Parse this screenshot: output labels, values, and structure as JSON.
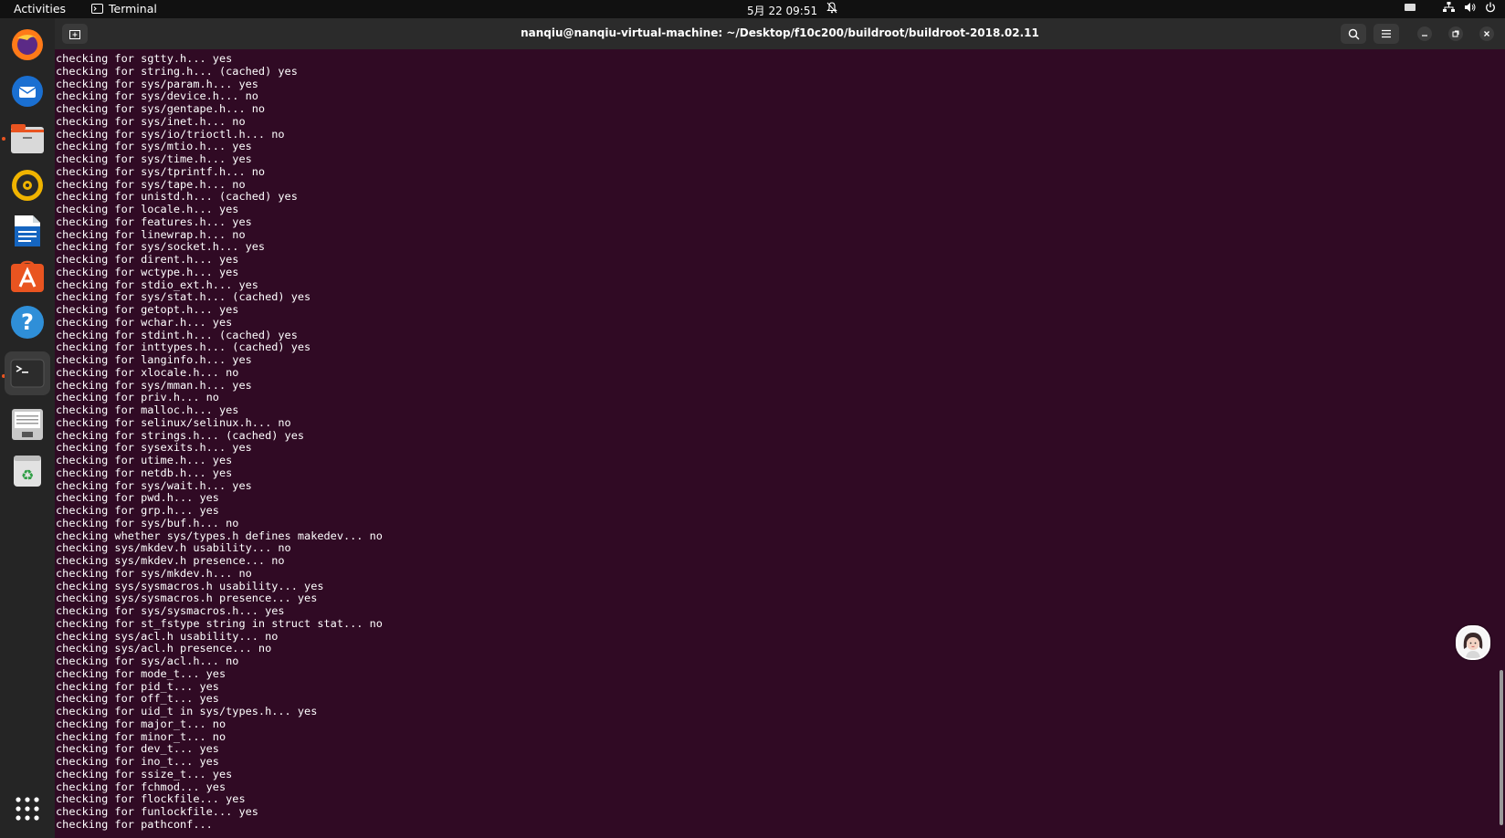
{
  "topbar": {
    "activities": "Activities",
    "app_name": "Terminal",
    "clock": "5月 22  09:51"
  },
  "dock": {
    "items": [
      "firefox-icon",
      "thunderbird-icon",
      "files-icon",
      "rhythmbox-icon",
      "writer-icon",
      "software-icon",
      "help-icon",
      "terminal-icon",
      "drive-icon",
      "trash-icon"
    ],
    "active_item": "terminal-icon"
  },
  "window": {
    "title": "nanqiu@nanqiu-virtual-machine: ~/Desktop/f10c200/buildroot/buildroot-2018.02.11"
  },
  "colors": {
    "terminal_bg": "#300a24",
    "terminal_fg": "#ffffff",
    "accent": "#e95420"
  },
  "terminal": {
    "lines": [
      "checking for sgtty.h... yes",
      "checking for string.h... (cached) yes",
      "checking for sys/param.h... yes",
      "checking for sys/device.h... no",
      "checking for sys/gentape.h... no",
      "checking for sys/inet.h... no",
      "checking for sys/io/trioctl.h... no",
      "checking for sys/mtio.h... yes",
      "checking for sys/time.h... yes",
      "checking for sys/tprintf.h... no",
      "checking for sys/tape.h... no",
      "checking for unistd.h... (cached) yes",
      "checking for locale.h... yes",
      "checking for features.h... yes",
      "checking for linewrap.h... no",
      "checking for sys/socket.h... yes",
      "checking for dirent.h... yes",
      "checking for wctype.h... yes",
      "checking for stdio_ext.h... yes",
      "checking for sys/stat.h... (cached) yes",
      "checking for getopt.h... yes",
      "checking for wchar.h... yes",
      "checking for stdint.h... (cached) yes",
      "checking for inttypes.h... (cached) yes",
      "checking for langinfo.h... yes",
      "checking for xlocale.h... no",
      "checking for sys/mman.h... yes",
      "checking for priv.h... no",
      "checking for malloc.h... yes",
      "checking for selinux/selinux.h... no",
      "checking for strings.h... (cached) yes",
      "checking for sysexits.h... yes",
      "checking for utime.h... yes",
      "checking for netdb.h... yes",
      "checking for sys/wait.h... yes",
      "checking for pwd.h... yes",
      "checking for grp.h... yes",
      "checking for sys/buf.h... no",
      "checking whether sys/types.h defines makedev... no",
      "checking sys/mkdev.h usability... no",
      "checking sys/mkdev.h presence... no",
      "checking for sys/mkdev.h... no",
      "checking sys/sysmacros.h usability... yes",
      "checking sys/sysmacros.h presence... yes",
      "checking for sys/sysmacros.h... yes",
      "checking for st_fstype string in struct stat... no",
      "checking sys/acl.h usability... no",
      "checking sys/acl.h presence... no",
      "checking for sys/acl.h... no",
      "checking for mode_t... yes",
      "checking for pid_t... yes",
      "checking for off_t... yes",
      "checking for uid_t in sys/types.h... yes",
      "checking for major_t... no",
      "checking for minor_t... no",
      "checking for dev_t... yes",
      "checking for ino_t... yes",
      "checking for ssize_t... yes",
      "checking for fchmod... yes",
      "checking for flockfile... yes",
      "checking for funlockfile... yes",
      "checking for pathconf..."
    ]
  }
}
